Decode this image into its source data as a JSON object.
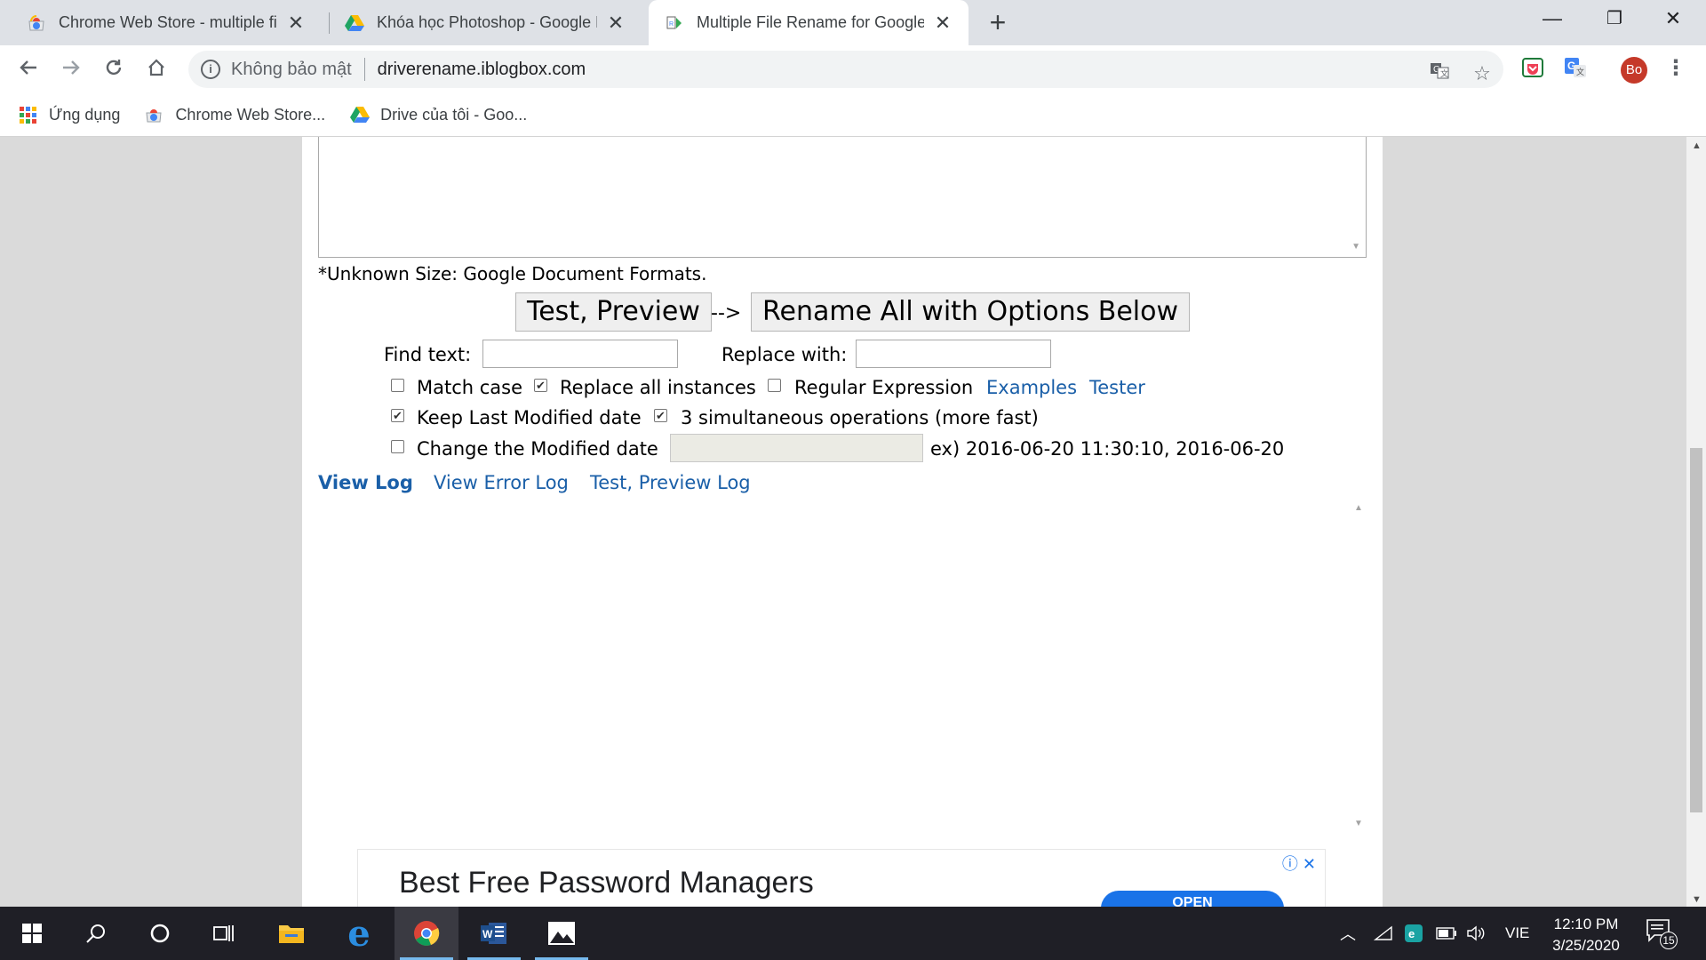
{
  "browser": {
    "tabs": [
      {
        "title": "Chrome Web Store - multiple file",
        "active": false
      },
      {
        "title": "Khóa học Photoshop - Google D",
        "active": false
      },
      {
        "title": "Multiple File Rename for Google",
        "active": true
      }
    ],
    "address": {
      "security_label": "Không bảo mật",
      "url": "driverename.iblogbox.com"
    },
    "avatar_initials": "Bo",
    "bookmarks": [
      {
        "label": "Ứng dụng",
        "icon": "apps-grid-icon"
      },
      {
        "label": "Chrome Web Store...",
        "icon": "chrome-web-store-icon"
      },
      {
        "label": "Drive của tôi - Goo...",
        "icon": "google-drive-icon"
      }
    ]
  },
  "page": {
    "unknown_size_note": "*Unknown Size: Google Document Formats.",
    "test_preview_button": "Test, Preview",
    "arrow": "-->",
    "rename_all_button": "Rename All with Options Below",
    "find_text_label": "Find text:",
    "find_text_value": "",
    "replace_with_label": "Replace with:",
    "replace_with_value": "",
    "options": {
      "match_case": {
        "label": "Match case",
        "checked": false
      },
      "replace_all": {
        "label": "Replace all instances",
        "checked": true
      },
      "regex": {
        "label": "Regular Expression",
        "checked": false
      },
      "examples_link": "Examples",
      "tester_link": "Tester",
      "keep_modified": {
        "label": "Keep Last Modified date",
        "checked": true
      },
      "simultaneous": {
        "label": "3 simultaneous operations (more fast)",
        "checked": true
      },
      "change_modified": {
        "label": "Change the Modified date",
        "checked": false
      },
      "date_example": "ex) 2016-06-20 11:30:10, 2016-06-20"
    },
    "log_links": {
      "view_log": "View Log",
      "view_error_log": "View Error Log",
      "test_preview_log": "Test, Preview Log"
    },
    "ad": {
      "title": "Best Free Password Managers",
      "button": "OPEN"
    }
  },
  "taskbar": {
    "language": "VIE",
    "time": "12:10 PM",
    "date": "3/25/2020",
    "notification_count": "15"
  },
  "colors": {
    "link": "#1a5fa8",
    "tab_strip": "#dee1e6",
    "taskbar": "#1f1f26",
    "avatar": "#c53929"
  }
}
